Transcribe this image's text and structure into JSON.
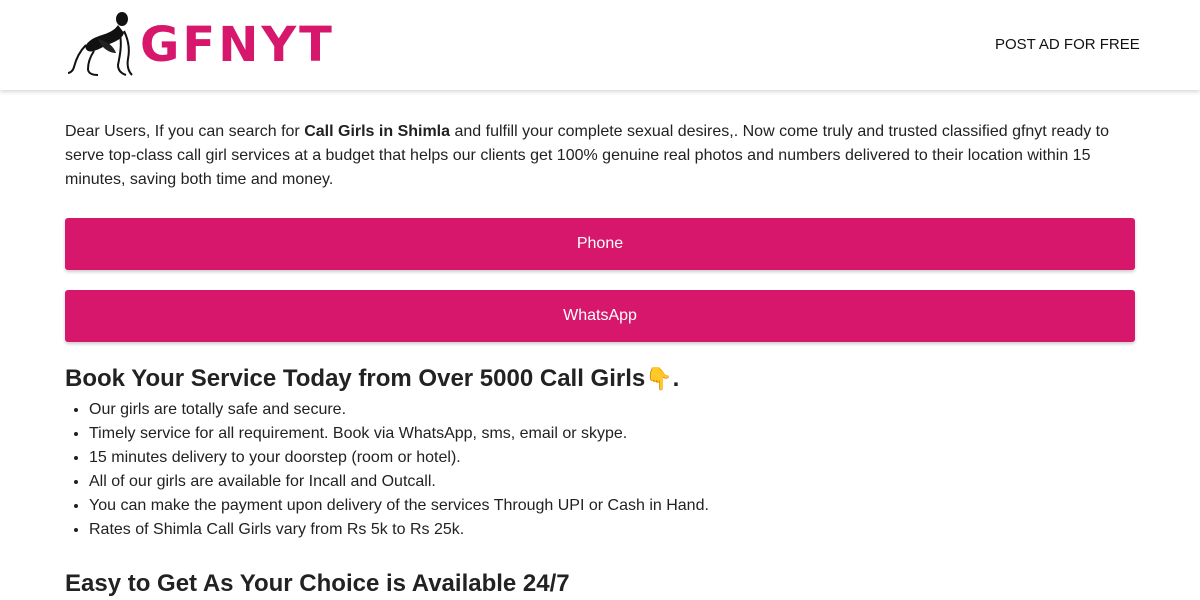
{
  "colors": {
    "brand": "#d6176b",
    "text": "#222222"
  },
  "header": {
    "logo_text": "GFNYT",
    "logo_icon": "kneeling-figure-icon",
    "post_ad": "POST AD FOR FREE"
  },
  "intro": {
    "before": "Dear Users, If you can search for ",
    "bold": "Call Girls in Shimla",
    "after": " and fulfill your complete sexual desires,. Now come truly and trusted classified gfnyt ready to serve top-class call girl services at a budget that helps our clients get 100% genuine real photos and numbers delivered to their location within 15 minutes, saving both time and money."
  },
  "buttons": {
    "phone": "Phone",
    "whatsapp": "WhatsApp"
  },
  "section1": {
    "heading": "Book Your Service Today from Over 5000 Call Girls",
    "emoji": "👇",
    "emoji_name": "pointing-down-icon",
    "heading_tail": ".",
    "items": [
      "Our girls are totally safe and secure.",
      "Timely service for all requirement. Book via WhatsApp, sms, email or skype.",
      "15 minutes delivery to your doorstep (room or hotel).",
      "All of our girls are available for Incall and Outcall.",
      "You can make the payment upon delivery of the services Through UPI or Cash in Hand.",
      "Rates of Shimla Call Girls vary from Rs 5k to Rs 25k."
    ]
  },
  "section2": {
    "heading": "Easy to Get As Your Choice is Available 24/7"
  }
}
